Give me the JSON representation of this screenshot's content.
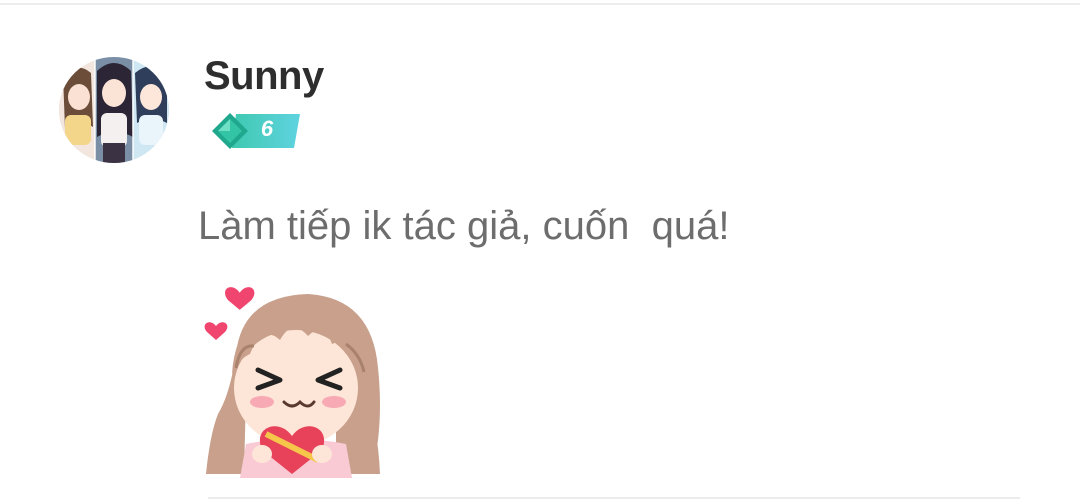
{
  "comment": {
    "username": "Sunny",
    "level": "6",
    "text": "Làm tiếp ik tác giả, cuốn  quá!",
    "sticker": "shy-girl-holding-heart-sticker"
  },
  "colors": {
    "username": "#2e2e2e",
    "comment_text": "#6d6d6d",
    "badge_start": "#3fc9b0",
    "badge_end": "#5fd3e0",
    "divider": "#ececec"
  }
}
